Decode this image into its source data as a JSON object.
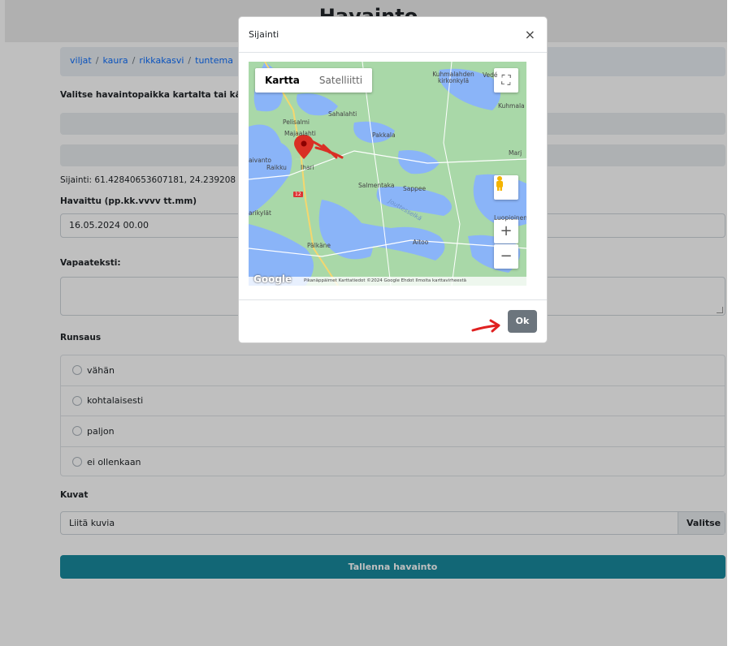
{
  "page": {
    "title": "Havainto",
    "breadcrumb": [
      "viljat",
      "kaura",
      "rikkakasvi",
      "tuntema"
    ],
    "instruction": "Valitse havaintopaikka kartalta tai käytä",
    "coords": "Sijainti: 61.42840653607181, 24.239208",
    "observed_label": "Havaittu (pp.kk.vvvv tt.mm)",
    "observed_value": "16.05.2024 00.00",
    "freetext_label": "Vapaateksti:",
    "abundance_label": "Runsaus",
    "abundance_options": [
      "vähän",
      "kohtalaisesti",
      "paljon",
      "ei ollenkaan"
    ],
    "images_label": "Kuvat",
    "file_placeholder": "Liitä kuvia",
    "file_button": "Valitse",
    "submit": "Tallenna havainto"
  },
  "modal": {
    "title": "Sijainti",
    "close": "×",
    "ok": "Ok",
    "map": {
      "tabs": [
        "Kartta",
        "Satelliitti"
      ],
      "places": [
        "Kuhmalahden kirkonkylä",
        "Vedé",
        "Kuhmala",
        "Sahalahti",
        "Pelisalmi",
        "Majaalahti",
        "Pakkala",
        "Marj",
        "aivanto",
        "Raikku",
        "Ihari",
        "Salmentaka",
        "Sappee",
        "Luopioinen",
        "arikylät",
        "Aitoo",
        "Pälkäne",
        "Jouttesselkä"
      ],
      "road": "12",
      "logo": "Google",
      "footer": "Pikanäppäimet   Karttatiedot ©2024 Google   Ehdot   Ilmoita karttavirheestä",
      "zoom_in": "+",
      "zoom_out": "−",
      "fullscreen": "⛶"
    }
  }
}
